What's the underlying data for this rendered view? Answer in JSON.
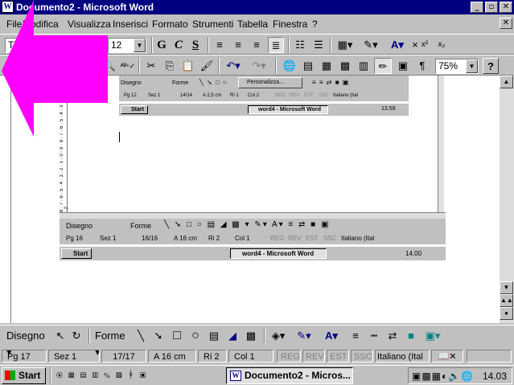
{
  "window": {
    "title": "Documento2 - Microsoft Word"
  },
  "menu": [
    "File",
    "Modifica",
    "Visualizza",
    "Inserisci",
    "Formato",
    "Strumenti",
    "Tabella",
    "Finestra",
    "?"
  ],
  "toolbar": {
    "font_name": "Tin",
    "font_size": "12",
    "bold": "G",
    "italic": "C",
    "underline": "S",
    "zoom": "75%",
    "help": "?",
    "pilcrow": "¶"
  },
  "draw_toolbar": {
    "disegno": "Disegno",
    "forme": "Forme"
  },
  "status": {
    "page": "Pg  17",
    "section": "Sez  1",
    "pages": "17/17",
    "at": "A  16 cm",
    "line": "Ri  2",
    "col": "Col  1",
    "rec": "REG",
    "rev": "REV",
    "est": "EST",
    "ssc": "SSC",
    "lang": "Italiano (Ital"
  },
  "taskbar": {
    "start": "Start",
    "task": "Documento2 - Micros...",
    "clock": "14.03"
  },
  "shot_small": {
    "menu_item": "Personalizza...",
    "disegno": "Disegno",
    "forme": "Forme",
    "page": "Pg 12",
    "section": "Sez 1",
    "pages": "14/14",
    "at": "A 2,5 cm",
    "line": "Ri 1",
    "col": "Col 2",
    "rec": "REG",
    "rev": "REV",
    "est": "EST",
    "ssc": "SSC",
    "lang": "Italiano (Ital",
    "start": "Start",
    "task": "word4 - Microsoft Word",
    "clock": "13.59"
  },
  "shot_big": {
    "disegno": "Disegno",
    "forme": "Forme",
    "page": "Pg 16",
    "section": "Sez 1",
    "pages": "16/16",
    "at": "A 16 cm",
    "line": "Ri 2",
    "col": "Col 1",
    "rec": "REG",
    "rev": "REV",
    "est": "EST",
    "ssc": "SSC",
    "lang": "Italiano (Ital",
    "start": "Start",
    "task": "word4 - Microsoft Word",
    "clock": "14.00",
    "ruler_ticks": "8 · 7 · 6 · 5 · 4 · 3 · 2 · 1 · 0 · 9 · 8 · 7 · 6 · 5 · 4 · 3 · 2 · 1 · 0 · 1 · 2"
  },
  "colors": {
    "titlebar": "#000080",
    "arrow": "#ff00ff",
    "face": "#c0c0c0"
  }
}
